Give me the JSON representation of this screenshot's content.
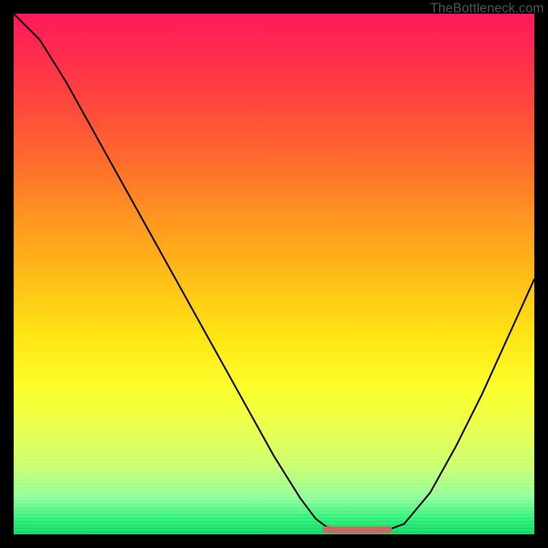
{
  "watermark": "TheBottleneck.com",
  "chart_data": {
    "type": "line",
    "title": "",
    "xlabel": "",
    "ylabel": "",
    "xlim": [
      0,
      100
    ],
    "ylim": [
      0,
      100
    ],
    "grid": false,
    "legend": false,
    "series": [
      {
        "name": "bottleneck-curve",
        "x": [
          0,
          5,
          10,
          15,
          20,
          25,
          30,
          35,
          40,
          45,
          50,
          55,
          58,
          60,
          63,
          66,
          69,
          72,
          75,
          80,
          85,
          90,
          95,
          100
        ],
        "y": [
          100,
          95,
          87,
          78,
          69,
          60,
          51,
          42,
          33,
          24,
          15,
          7,
          3,
          1.5,
          0.9,
          0.8,
          0.8,
          0.9,
          2,
          8,
          17,
          27,
          38,
          49
        ]
      },
      {
        "name": "optimal-zone-marker",
        "x": [
          60,
          63,
          66,
          69,
          72
        ],
        "y": [
          0.9,
          0.8,
          0.8,
          0.8,
          0.9
        ]
      }
    ],
    "colors": {
      "curve": "#000000",
      "marker": "#c46a63",
      "gradient_top": "#ff1a5c",
      "gradient_mid": "#ffd21a",
      "gradient_bottom": "#0ad85e"
    }
  }
}
